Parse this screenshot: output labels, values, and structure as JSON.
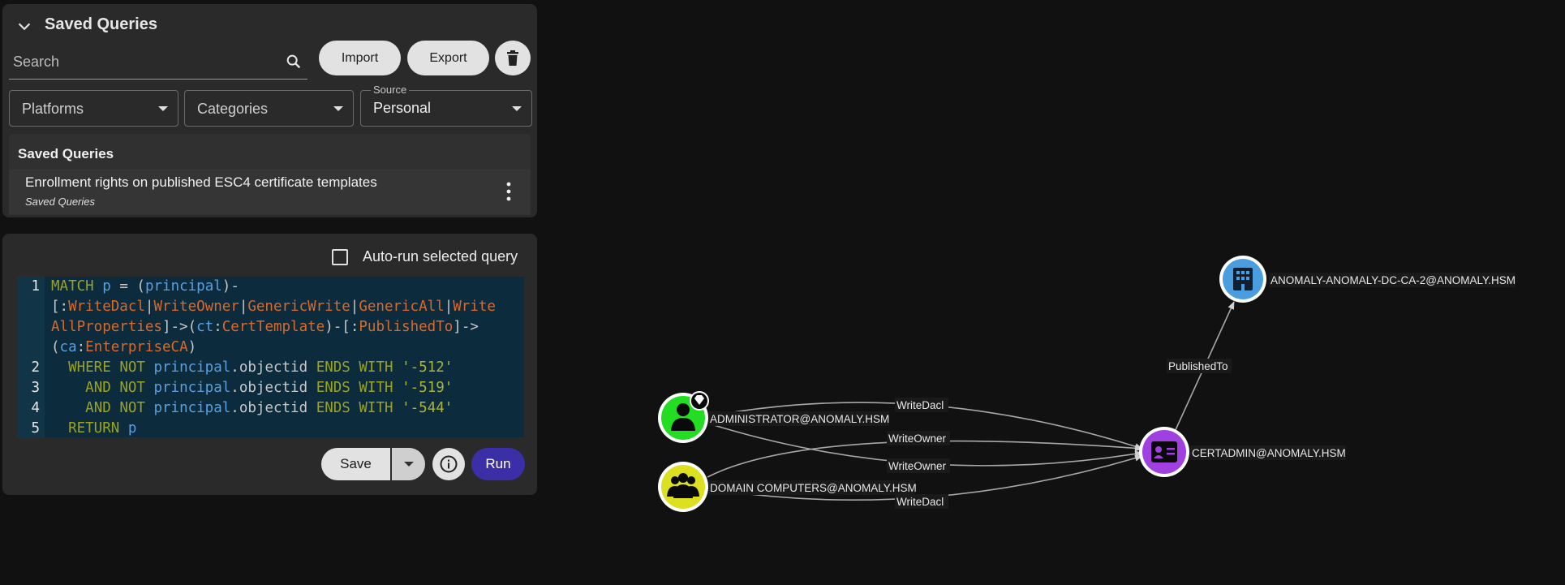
{
  "saved_queries_panel": {
    "title": "Saved Queries",
    "search_placeholder": "Search",
    "import_label": "Import",
    "export_label": "Export",
    "platforms_label": "Platforms",
    "categories_label": "Categories",
    "source_legend": "Source",
    "source_value": "Personal",
    "list_header": "Saved Queries",
    "items": [
      {
        "title": "Enrollment rights on published ESC4 certificate templates",
        "subtitle": "Saved Queries"
      }
    ]
  },
  "editor": {
    "auto_run_label": "Auto-run selected query",
    "auto_run_checked": false,
    "line_numbers": [
      "1",
      "2",
      "3",
      "4",
      "5"
    ],
    "code_lines": [
      "MATCH p = (principal)-",
      "[:WriteDacl|WriteOwner|GenericWrite|GenericAll|Write",
      "AllProperties]->(ct:CertTemplate)-[:PublishedTo]->",
      "(ca:EnterpriseCA)",
      "  WHERE NOT principal.objectid ENDS WITH '-512'",
      "    AND NOT principal.objectid ENDS WITH '-519'",
      "    AND NOT principal.objectid ENDS WITH '-544'",
      "  RETURN p"
    ],
    "save_label": "Save",
    "run_label": "Run"
  },
  "graph": {
    "nodes": [
      {
        "id": "ca",
        "label": "ANOMALY-ANOMALY-DC-CA-2@ANOMALY.HSM",
        "color": "#4a9ee0",
        "icon": "building-icon"
      },
      {
        "id": "admin",
        "label": "ADMINISTRATOR@ANOMALY.HSM",
        "color": "#22dd22",
        "icon": "user-icon",
        "badge": "gem-icon"
      },
      {
        "id": "cert",
        "label": "CERTADMIN@ANOMALY.HSM",
        "color": "#a040e0",
        "icon": "id-card-icon"
      },
      {
        "id": "computers",
        "label": "DOMAIN COMPUTERS@ANOMALY.HSM",
        "color": "#dde020",
        "icon": "group-icon"
      }
    ],
    "edges": [
      {
        "label": "PublishedTo"
      },
      {
        "label": "WriteDacl"
      },
      {
        "label": "WriteOwner"
      },
      {
        "label": "WriteOwner"
      },
      {
        "label": "WriteDacl"
      }
    ]
  }
}
